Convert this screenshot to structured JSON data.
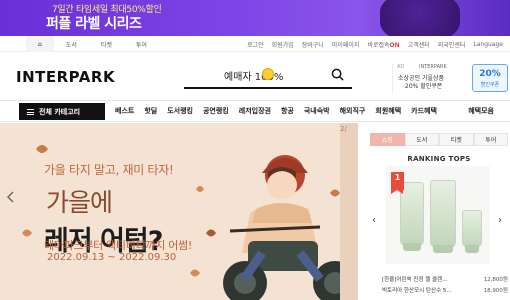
{
  "promo": {
    "line1": "7일간 타임세일 최대50%할인",
    "line2": "퍼플 라벨 시리즈"
  },
  "util": {
    "tabs": [
      "⌂",
      "도서",
      "티켓",
      "투어"
    ],
    "right": [
      "로그인",
      "회원가입",
      "장바구니",
      "마이페이지",
      "바로접속",
      "ON",
      "고객센터",
      "외국인센터",
      "Language"
    ]
  },
  "header": {
    "logo": "INTERPARK",
    "search_keyword": "예매자 100%",
    "ad_label": "AD",
    "ad_brand": "INTERPARK",
    "ad_line1": "소상공인 가을상품",
    "ad_line2": "20% 할인쿠폰",
    "coupon_pct": "20%",
    "coupon_label": "할인쿠폰"
  },
  "nav": {
    "all_categories": "전체 카테고리",
    "items": [
      "베스트",
      "핫딜",
      "도서랭킹",
      "공연랭킹",
      "레저입장권",
      "항공",
      "국내숙박",
      "해외직구",
      "회원혜택",
      "카드혜택"
    ],
    "right": "혜택모음"
  },
  "hero": {
    "pager": "2/",
    "headline": "가을 타지 말고, 재미 타자!",
    "big1": "가을에",
    "big2": "레저 어텀?",
    "desc": "테마파크부터 액티비티까지 어썸!",
    "dates": "2022.09.13 ~ 2022.09.30"
  },
  "ranking": {
    "tabs": [
      "쇼핑",
      "도서",
      "티켓",
      "투어"
    ],
    "active_tab": "쇼핑",
    "title": "RANKING TOPS",
    "badge": "1",
    "items": [
      {
        "name": "[한율]어린쑥 진정 젤 클렌...",
        "price": "12,800원"
      },
      {
        "name": "빅토리아 한산모시 탄산수 5...",
        "price": "18,900원"
      }
    ]
  },
  "colors": {
    "promo_purple": "#7d44e6",
    "nav_black": "#111111",
    "hero_bg": "#f4e2d2",
    "rank_active": "#f0b6ab",
    "badge_red": "#e94b3c"
  }
}
